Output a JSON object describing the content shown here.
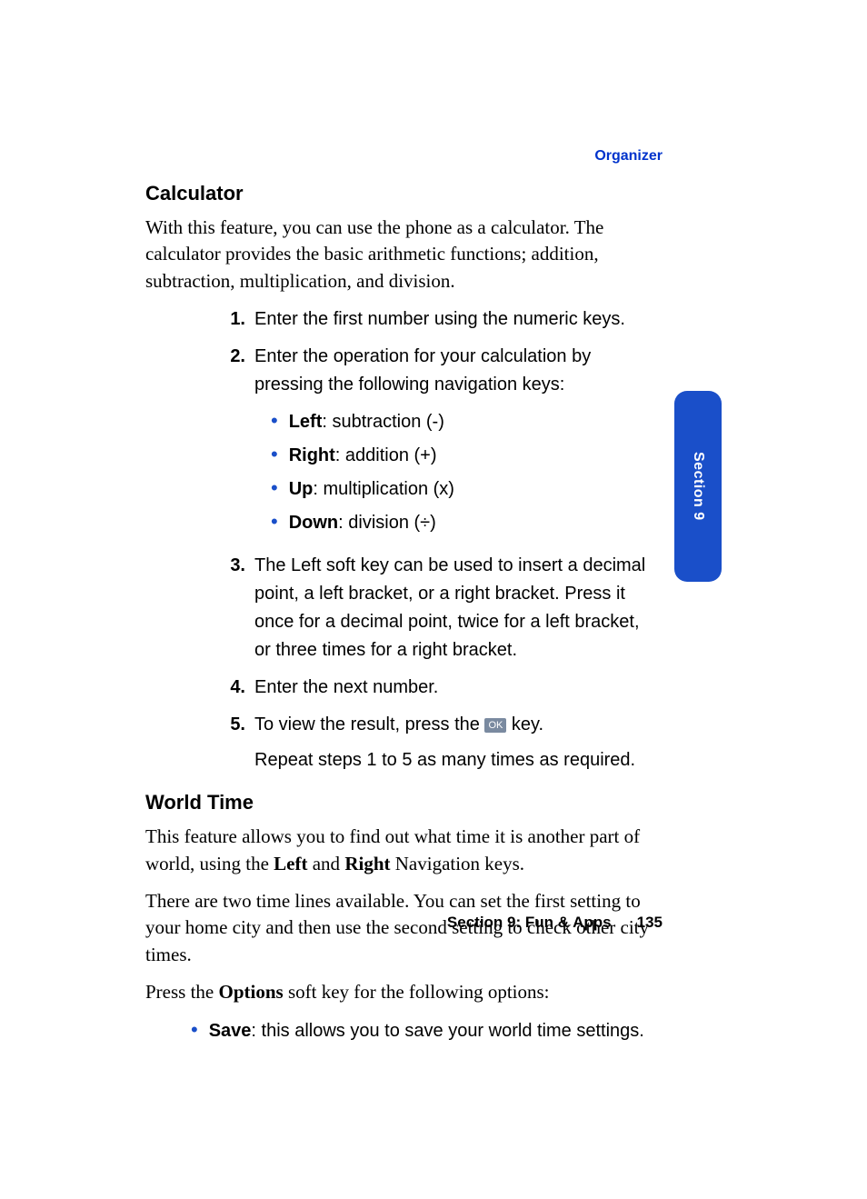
{
  "header": {
    "label": "Organizer"
  },
  "tab": {
    "text": "Section 9"
  },
  "calculator": {
    "heading": "Calculator",
    "intro": "With this feature, you can use the phone as a calculator. The calculator provides the basic arithmetic functions; addition, subtraction, multiplication, and division.",
    "steps": {
      "s1": {
        "num": "1.",
        "text": "Enter the first number using the numeric keys."
      },
      "s2": {
        "num": "2.",
        "text": "Enter the operation for your calculation by pressing the following navigation keys:"
      },
      "nav": {
        "left": {
          "label": "Left",
          "desc": ": subtraction (-)"
        },
        "right": {
          "label": "Right",
          "desc": ": addition (+)"
        },
        "up": {
          "label": "Up",
          "desc": ": multiplication (x)"
        },
        "down": {
          "label": "Down",
          "desc": ": division (÷)"
        }
      },
      "s3": {
        "num": "3.",
        "text": "The Left soft key can be used to insert a decimal point, a left bracket, or a right bracket. Press it once for a decimal point, twice for a left bracket, or three times for a right bracket."
      },
      "s4": {
        "num": "4.",
        "text": "Enter the next number."
      },
      "s5": {
        "num": "5.",
        "text_before": "To view the result, press the ",
        "ok": "OK",
        "text_after": " key.",
        "repeat": "Repeat steps 1 to 5 as many times as required."
      }
    }
  },
  "worldtime": {
    "heading": "World Time",
    "p1_before": "This feature allows you to find out what time it is another part of world, using the ",
    "p1_left": "Left",
    "p1_mid": " and ",
    "p1_right": "Right",
    "p1_after": " Navigation keys.",
    "p2": "There are two time lines available. You can set the first setting to your home city and then use the second setting to check other city times.",
    "p3_before": "Press the ",
    "p3_options": "Options",
    "p3_after": " soft key for the following options:",
    "save": {
      "label": "Save",
      "desc": ": this allows you to save your world time settings."
    }
  },
  "footer": {
    "section": "Section 9: Fun & Apps",
    "page": "135"
  }
}
